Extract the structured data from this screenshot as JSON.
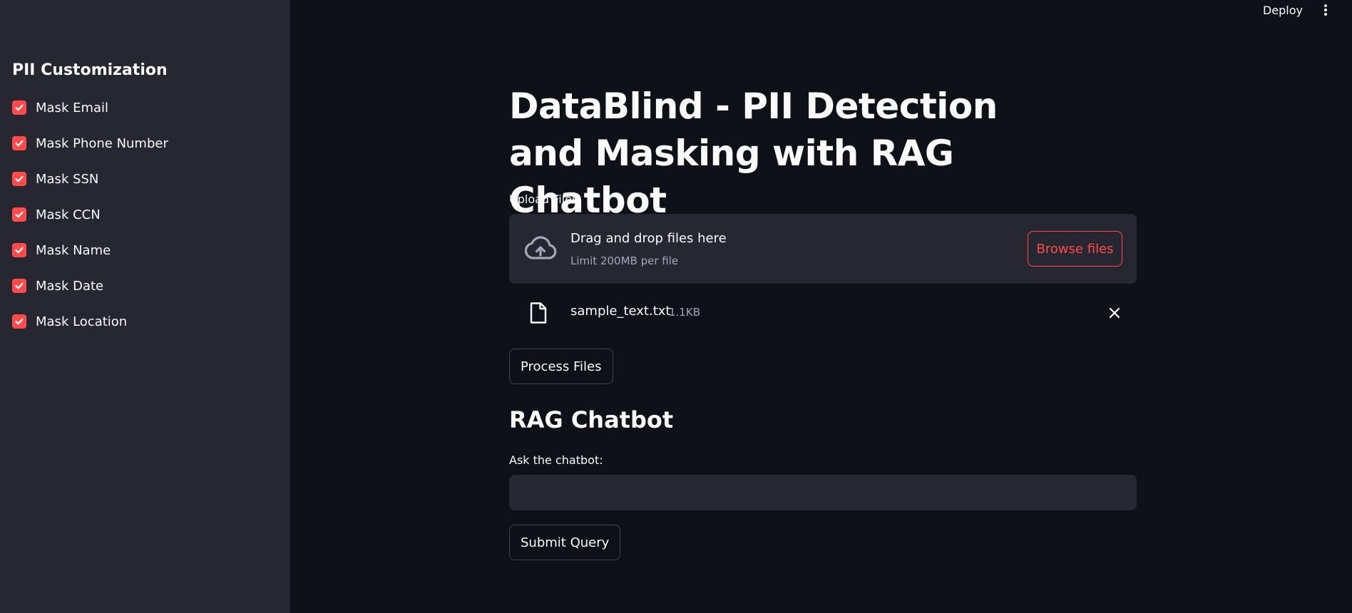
{
  "colors": {
    "background": "#0e1117",
    "sidebar": "#262730",
    "accent": "#ff4b4b",
    "text": "#fafafa",
    "muted": "#a3a8b8"
  },
  "header": {
    "deploy_label": "Deploy",
    "menu_icon": "kebab-vertical-icon"
  },
  "sidebar": {
    "title": "PII Customization",
    "checkboxes": [
      {
        "label": "Mask Email",
        "checked": true
      },
      {
        "label": "Mask Phone Number",
        "checked": true
      },
      {
        "label": "Mask SSN",
        "checked": true
      },
      {
        "label": "Mask CCN",
        "checked": true
      },
      {
        "label": "Mask Name",
        "checked": true
      },
      {
        "label": "Mask Date",
        "checked": true
      },
      {
        "label": "Mask Location",
        "checked": true
      }
    ]
  },
  "main": {
    "title": "DataBlind - PII Detection and Masking with RAG Chatbot",
    "upload": {
      "label": "Upload Files",
      "dropzone_text": "Drag and drop files here",
      "limit_text": "Limit 200MB per file",
      "browse_label": "Browse files",
      "icon": "cloud-upload-icon",
      "file": {
        "name": "sample_text.txt",
        "size": "1.1KB",
        "icon": "file-icon",
        "remove_icon": "close-icon"
      }
    },
    "process_label": "Process Files",
    "chatbot": {
      "title": "RAG Chatbot",
      "input_label": "Ask the chatbot:",
      "input_value": "",
      "submit_label": "Submit Query"
    }
  }
}
